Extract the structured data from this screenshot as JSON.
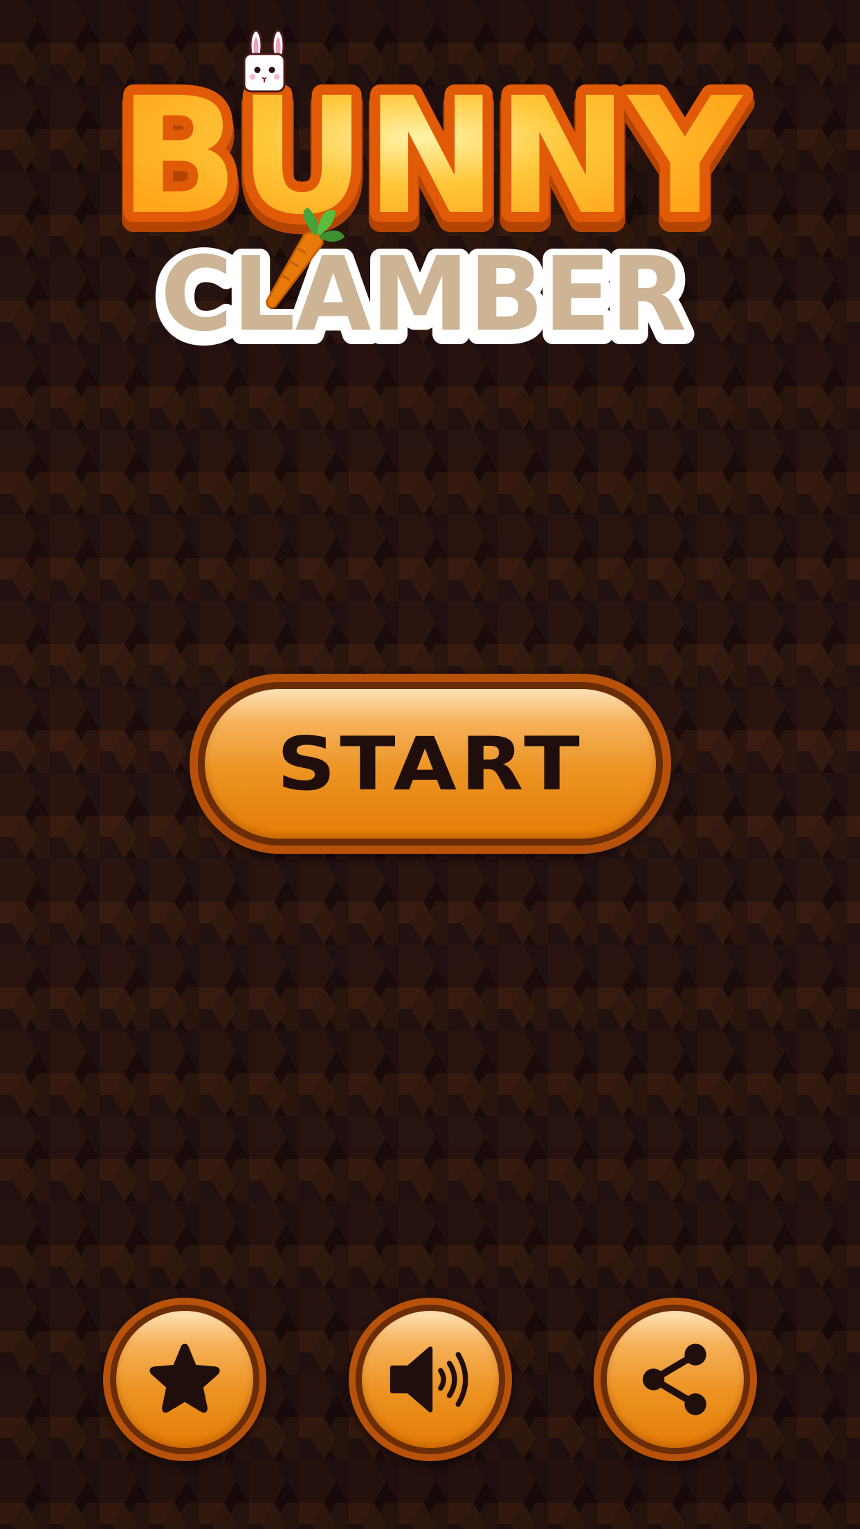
{
  "title": {
    "line1": "BUNNY",
    "line2": "CLAMBER"
  },
  "start_button": {
    "label": "START"
  },
  "bottom_buttons": [
    {
      "icon": "star-icon"
    },
    {
      "icon": "speaker-icon"
    },
    {
      "icon": "share-icon"
    }
  ],
  "colors": {
    "background": "#1b0b0b",
    "title_orange": "#ffb21f",
    "title_outline": "#e05a08",
    "subtitle_beige": "#cdb495",
    "button_orange": "#e9891a",
    "button_ring": "#6a2d07",
    "icon_dark": "#1f0e0c"
  }
}
